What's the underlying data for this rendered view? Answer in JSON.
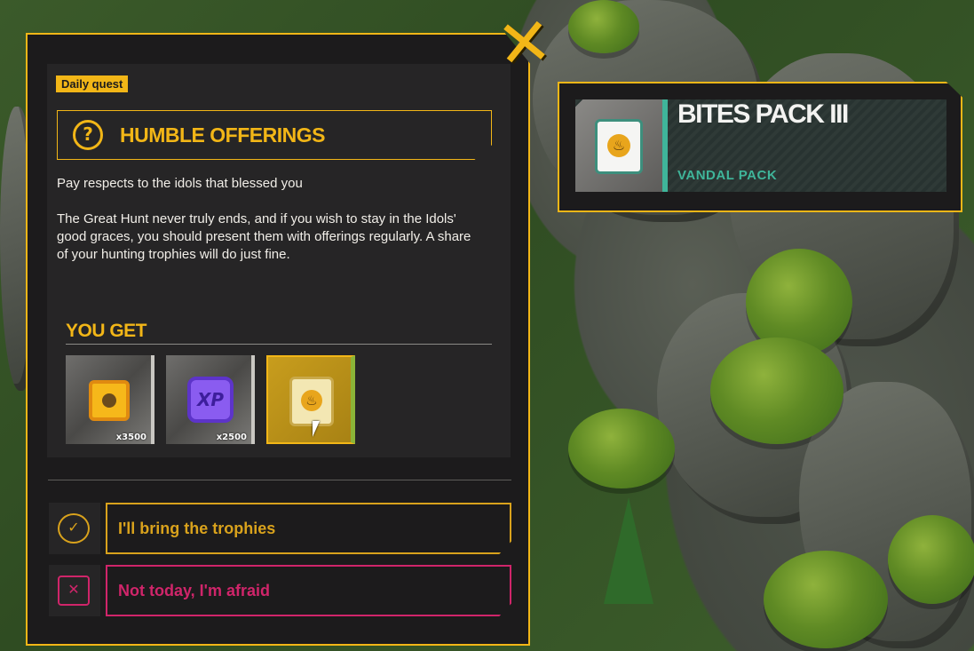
{
  "quest": {
    "badge": "Daily quest",
    "title": "HUMBLE OFFERINGS",
    "title_icon": "quest-question-icon",
    "subtitle": "Pay respects to the idols that blessed you",
    "description": "The Great Hunt never truly ends, and if you wish to stay in the Idols' good graces, you should present them with offerings regularly. A share of your hunting trophies will do just fine.",
    "you_get_label": "YOU GET",
    "rewards": [
      {
        "icon": "coin-icon",
        "quantity": "x3500",
        "selected": false
      },
      {
        "icon": "xp-icon",
        "icon_text": "XP",
        "quantity": "x2500",
        "selected": false
      },
      {
        "icon": "bites-pack-chest-icon",
        "quantity": "",
        "selected": true
      }
    ],
    "options": [
      {
        "icon": "check-icon",
        "icon_glyph": "✓",
        "label": "I'll bring the trophies",
        "color": "#d9a21c"
      },
      {
        "icon": "cancel-x-icon",
        "icon_glyph": "✕",
        "label": "Not today, I'm afraid",
        "color": "#d0256a"
      }
    ],
    "close_glyph": "✕"
  },
  "tooltip": {
    "title": "BITES PACK III",
    "subtitle": "VANDAL PACK",
    "accent_color": "#3fb59a"
  },
  "colors": {
    "accent": "#f2b617",
    "panel_bg": "#1c1b1c"
  }
}
